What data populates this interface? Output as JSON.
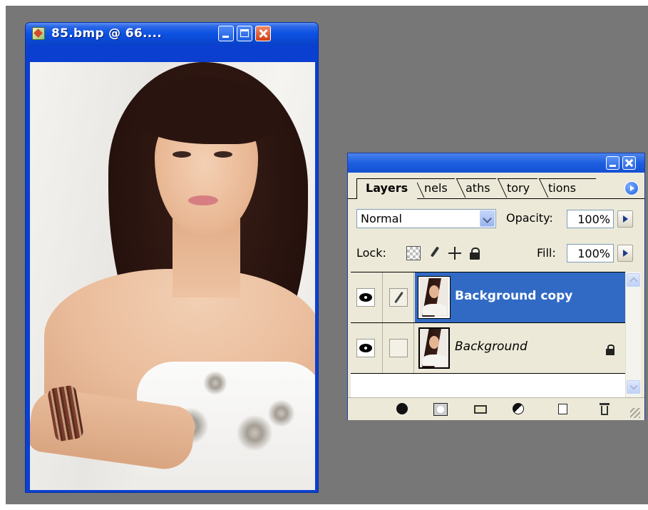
{
  "document_window": {
    "title": "85.bmp @ 66....",
    "icon": "photoshop-document-icon",
    "controls": [
      "minimize-icon",
      "maximize-icon",
      "close-icon"
    ],
    "colors": {
      "titlebar": "#0c52e3",
      "close": "#d23e14"
    }
  },
  "layers_panel": {
    "controls": [
      "minimize-icon",
      "close-icon"
    ],
    "tabs": [
      {
        "label": "Layers",
        "active": true
      },
      {
        "label": "nels",
        "active": false
      },
      {
        "label": "aths",
        "active": false
      },
      {
        "label": "tory",
        "active": false
      },
      {
        "label": "tions",
        "active": false
      }
    ],
    "blend_mode": "Normal",
    "opacity_label": "Opacity:",
    "opacity_value": "100%",
    "lock_label": "Lock:",
    "lock_icons": [
      "lock-transparent-icon",
      "lock-image-brush-icon",
      "lock-position-move-icon",
      "lock-all-icon"
    ],
    "fill_label": "Fill:",
    "fill_value": "100%",
    "layers": [
      {
        "name": "Background copy",
        "visible": true,
        "selected": true,
        "link_icon": "brush-icon",
        "locked": false
      },
      {
        "name": "Background",
        "visible": true,
        "selected": false,
        "link_icon": "",
        "locked": true
      }
    ],
    "footer_icons": [
      "layer-style-icon",
      "layer-mask-icon",
      "new-group-icon",
      "adjustment-layer-icon",
      "new-layer-icon",
      "trash-icon"
    ],
    "colors": {
      "selection": "#316ac5",
      "panel_bg": "#ece9d8"
    }
  },
  "workspace": {
    "background": "#777777"
  }
}
